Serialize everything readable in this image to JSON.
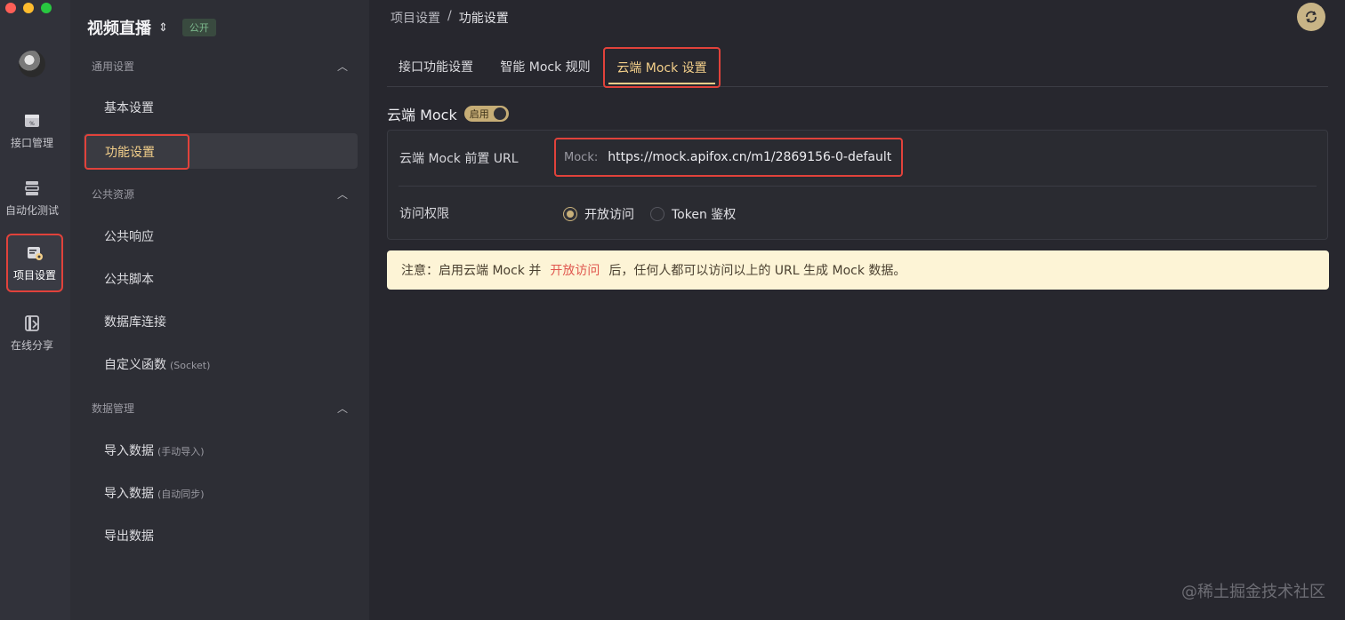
{
  "window": {
    "traffic_colors": [
      "#ff5f57",
      "#febc2e",
      "#28c840"
    ]
  },
  "rail": {
    "items": [
      {
        "label": "接口管理",
        "icon": "api-management-icon"
      },
      {
        "label": "自动化测试",
        "icon": "automation-test-icon"
      },
      {
        "label": "项目设置",
        "icon": "project-settings-icon",
        "active": true
      },
      {
        "label": "在线分享",
        "icon": "online-share-icon"
      }
    ]
  },
  "sidebar": {
    "project_name": "视频直播",
    "public_badge": "公开",
    "groups": [
      {
        "title": "通用设置",
        "items": [
          "基本设置",
          "功能设置"
        ]
      },
      {
        "title": "公共资源",
        "items": [
          "公共响应",
          "公共脚本",
          "数据库连接",
          "自定义函数"
        ]
      },
      {
        "title": "数据管理",
        "items": [
          "导入数据",
          "导入数据",
          "导出数据"
        ]
      }
    ],
    "item_subs": {
      "custom_func": "(Socket)",
      "import_manual": "(手动导入)",
      "import_auto": "(自动同步)"
    },
    "active_item": "功能设置"
  },
  "breadcrumb": {
    "parent": "项目设置",
    "separator": "/",
    "current": "功能设置"
  },
  "tabs": [
    "接口功能设置",
    "智能 Mock 规则",
    "云端 Mock 设置"
  ],
  "active_tab": "云端 Mock 设置",
  "section": {
    "title": "云端 Mock",
    "toggle_label": "启用",
    "toggle_on": true
  },
  "form": {
    "url_label": "云端 Mock 前置 URL",
    "url_prefix": "Mock:",
    "url_value": "https://mock.apifox.cn/m1/2869156-0-default",
    "access_label": "访问权限",
    "access_options": [
      "开放访问",
      "Token 鉴权"
    ],
    "access_selected": "开放访问"
  },
  "notice": {
    "before": "注意：启用云端 Mock 并",
    "highlight": "开放访问",
    "after": "后，任何人都可以访问以上的 URL 生成 Mock 数据。"
  },
  "watermark": "@稀土掘金技术社区",
  "colors": {
    "accent": "#f3cf8a",
    "highlight_border": "#e1423b",
    "notice_bg": "#fdf4d6"
  }
}
